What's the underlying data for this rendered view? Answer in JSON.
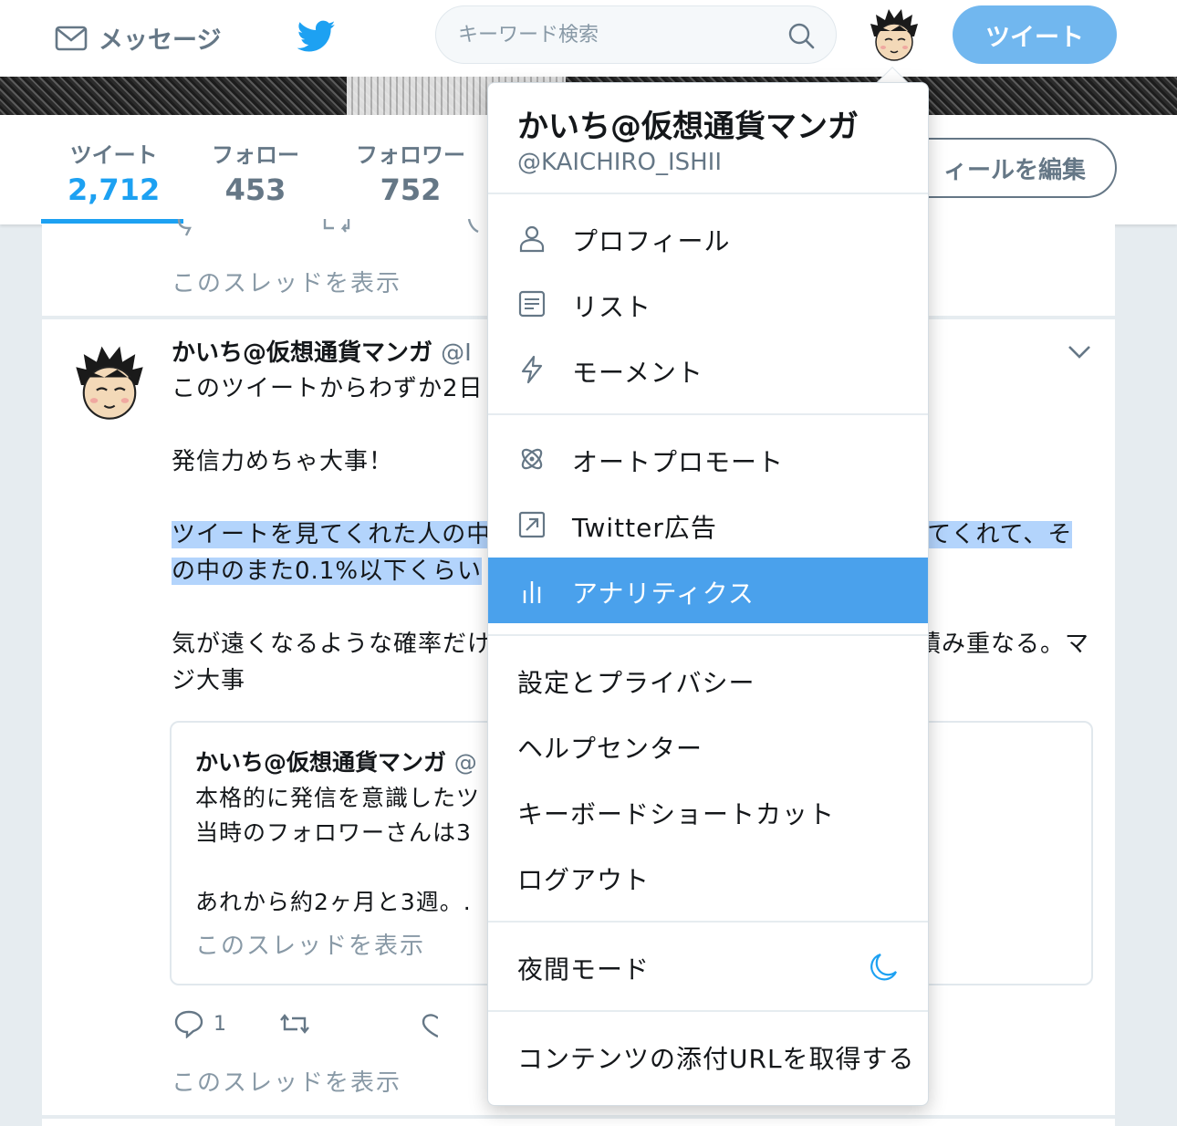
{
  "nav": {
    "messages_label": "メッセージ",
    "search_placeholder": "キーワード検索",
    "tweet_button": "ツイート"
  },
  "profile": {
    "stats": [
      {
        "label": "ツイート",
        "value": "2,712"
      },
      {
        "label": "フォロー",
        "value": "453"
      },
      {
        "label": "フォロワー",
        "value": "752"
      }
    ],
    "edit_button": "ィールを編集"
  },
  "timeline": {
    "prev_thread_link": "このスレッドを表示",
    "tweet": {
      "author": "かいち@仮想通貨マンガ",
      "handle_fragment": "@I",
      "text_line1": "このツイートからわずか2日",
      "text_line2": "発信力めちゃ大事！",
      "highlight_line1_a": "ツイートを見てくれた人の中",
      "highlight_line1_b": "てくれて、そ",
      "highlight_line2": "の中のまた0.1%以下くらい",
      "text_line4_a": "気が遠くなるような確率だけ",
      "text_line4_b": "積み重なる。マ",
      "text_line5": "ジ大事",
      "quote": {
        "author": "かいち@仮想通貨マンガ",
        "handle_fragment": "@",
        "line1": "本格的に発信を意識したツ",
        "line2": "当時のフォロワーさんは3",
        "line3": "あれから約2ヶ月と3週。.",
        "thread_link": "このスレッドを表示"
      },
      "reply_count": "1",
      "thread_link": "このスレッドを表示"
    }
  },
  "menu": {
    "name": "かいち@仮想通貨マンガ",
    "handle": "@KAICHIRO_ISHII",
    "group1": [
      "プロフィール",
      "リスト",
      "モーメント"
    ],
    "group2": [
      "オートプロモート",
      "Twitter広告",
      "アナリティクス"
    ],
    "group3": [
      "設定とプライバシー",
      "ヘルプセンター",
      "キーボードショートカット",
      "ログアウト"
    ],
    "night_mode": "夜間モード",
    "get_url": "コンテンツの添付URLを取得する"
  },
  "colors": {
    "accent": "#1da1f2",
    "active_menu": "#4aa1ec",
    "tweet_button": "#71b7ef",
    "highlight": "#b3d4fc"
  }
}
